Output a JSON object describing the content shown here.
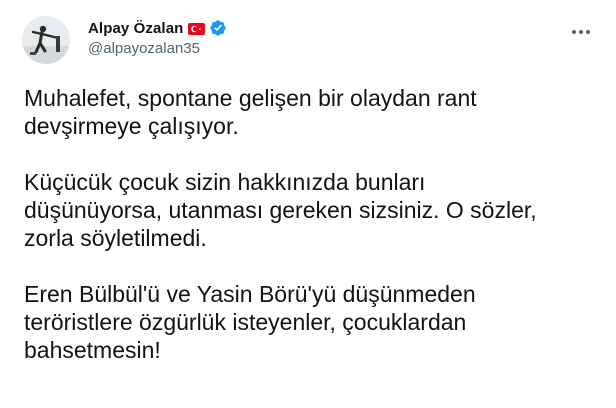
{
  "tweet": {
    "author": {
      "display_name": "Alpay Özalan",
      "handle": "@alpayozalan35",
      "flag_icon": "turkey-flag-icon",
      "verified_icon": "verified-badge-icon",
      "verified_color": "#1d9bf0"
    },
    "more_icon": "more-options-icon",
    "paragraphs": [
      {
        "lines": [
          "Muhalefet, spontane gelişen bir olaydan rant",
          "devşirmeye çalışıyor."
        ]
      },
      {
        "lines": [
          "Küçücük çocuk sizin hakkınızda bunları",
          "düşünüyorsa, utanması gereken sizsiniz. O sözler,",
          "zorla söyletilmedi."
        ]
      },
      {
        "lines": [
          "Eren Bülbül'ü ve Yasin Börü'yü düşünmeden",
          "teröristlere özgürlük isteyenler, çocuklardan",
          "bahsetmesin!"
        ]
      }
    ]
  },
  "colors": {
    "text_primary": "#0f1419",
    "text_secondary": "#536471",
    "flag_red": "#e30a17",
    "verified_blue": "#1d9bf0"
  }
}
